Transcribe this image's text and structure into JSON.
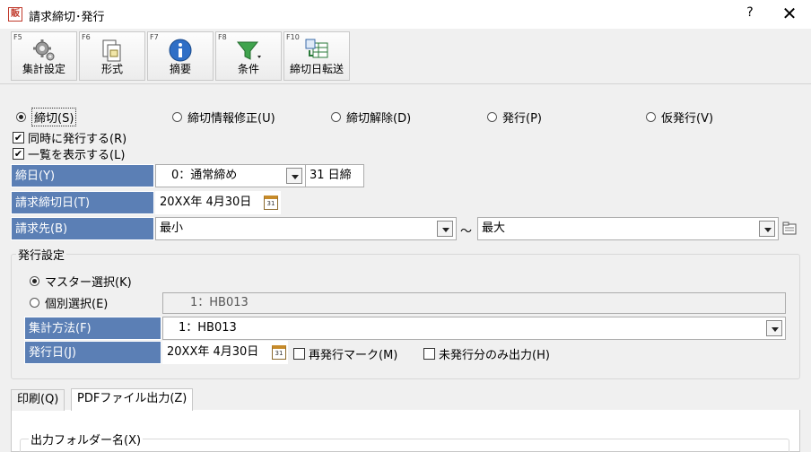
{
  "window": {
    "icon_text": "販",
    "title": "請求締切･発行",
    "help": "?",
    "close": "✕"
  },
  "toolbar": {
    "buttons": [
      {
        "fkey": "F5",
        "label": "集計設定",
        "icon": "gear-icon"
      },
      {
        "fkey": "F6",
        "label": "形式",
        "icon": "document-format-icon"
      },
      {
        "fkey": "F7",
        "label": "摘要",
        "icon": "info-icon"
      },
      {
        "fkey": "F8",
        "label": "条件",
        "icon": "filter-icon"
      },
      {
        "fkey": "F10",
        "label": "締切日転送",
        "icon": "table-transfer-icon"
      }
    ]
  },
  "mode": {
    "options": [
      {
        "label": "締切(S)",
        "selected": true
      },
      {
        "label": "締切情報修正(U)",
        "selected": false
      },
      {
        "label": "締切解除(D)",
        "selected": false
      },
      {
        "label": "発行(P)",
        "selected": false
      },
      {
        "label": "仮発行(V)",
        "selected": false
      }
    ]
  },
  "options": {
    "simultaneous_issue": {
      "label": "同時に発行する(R)",
      "checked": true
    },
    "show_list": {
      "label": "一覧を表示する(L)",
      "checked": true
    }
  },
  "form": {
    "closing_day": {
      "label": "締日(Y)",
      "value": "　0：通常締め",
      "suffix": "31 日締"
    },
    "billing_cutoff_date": {
      "label": "請求締切日(T)",
      "value": "20XX年 4月30日"
    },
    "billing_to": {
      "label": "請求先(B)",
      "from": "最小",
      "tilde": "～",
      "to": "最大"
    }
  },
  "issue_settings": {
    "title": "発行設定",
    "selection": [
      {
        "label": "マスター選択(K)",
        "selected": true
      },
      {
        "label": "個別選択(E)",
        "selected": false
      }
    ],
    "individual_value": "　　1：HB013",
    "aggregation_method": {
      "label": "集計方法(F)",
      "value": "　1：HB013"
    },
    "issue_date": {
      "label": "発行日(J)",
      "value": "20XX年 4月30日"
    },
    "reissue_mark": {
      "label": "再発行マーク(M)",
      "checked": false
    },
    "unissued_only": {
      "label": "未発行分のみ出力(H)",
      "checked": false
    }
  },
  "tabs": [
    {
      "label": "印刷(Q)",
      "active": false
    },
    {
      "label": "PDFファイル出力(Z)",
      "active": true
    }
  ],
  "output": {
    "folder_title": "出力フォルダー名(X)"
  },
  "colors": {
    "label_bg": "#5b7fb5",
    "window_bg": "#f0f0f0"
  }
}
